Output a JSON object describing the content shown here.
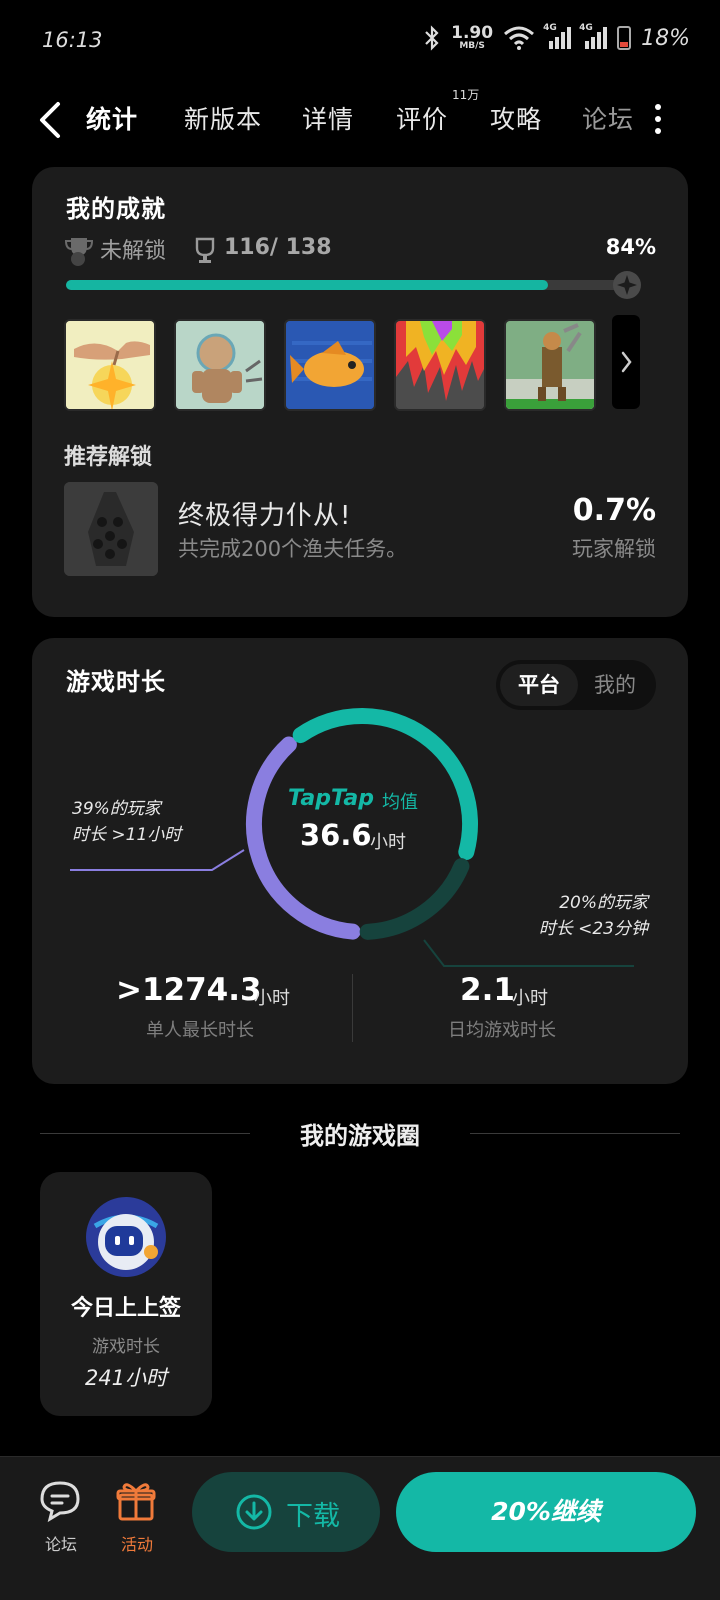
{
  "status_bar": {
    "time": "16:13",
    "net_speed_value": "1.90",
    "net_speed_unit": "MB/S",
    "signal1_label": "4G",
    "signal2_label": "4G",
    "battery": "18%"
  },
  "tabs": {
    "items": [
      "统计",
      "新版本",
      "详情",
      "评价",
      "攻略",
      "论坛"
    ],
    "active_index": 0,
    "review_badge": "11万"
  },
  "achievements": {
    "title": "我的成就",
    "locked_label": "未解锁",
    "count": "116/ 138",
    "progress_text": "84%",
    "progress": 0.84,
    "recommend_title": "推荐解锁",
    "recommend_name": "终极得力仆从!",
    "recommend_desc": "共完成200个渔夫任务。",
    "recommend_rate": "0.7%",
    "recommend_rate_label": "玩家解锁"
  },
  "playtime": {
    "title": "游戏时长",
    "toggle_platform": "平台",
    "toggle_mine": "我的",
    "center_brand": "TapTap",
    "center_label": "均值",
    "center_value": "36.6",
    "center_unit": "小时",
    "left_note_line1": "39%的玩家",
    "left_note_line2": "时长 >11小时",
    "right_note_line1": "20%的玩家",
    "right_note_line2": "时长 <23分钟",
    "max_value": ">1274.3",
    "max_unit": "小时",
    "max_label": "单人最长时长",
    "avg_value": "2.1",
    "avg_unit": "小时",
    "avg_label": "日均游戏时长",
    "segments": {
      "purple_pct": 39,
      "teal_pct": 41,
      "dark_pct": 20
    },
    "colors": {
      "purple": "#8a7ee0",
      "teal": "#14b8a6",
      "dark": "#16433d"
    }
  },
  "circle": {
    "section_title": "我的游戏圈",
    "name": "今日上上签",
    "stat_label": "游戏时长",
    "stat_value": "241小时"
  },
  "bottom": {
    "forum_label": "论坛",
    "event_label": "活动",
    "download_label": "下载",
    "continue_label": "20%继续"
  },
  "colors": {
    "accent": "#14b8a6",
    "orange": "#f07a3a"
  }
}
